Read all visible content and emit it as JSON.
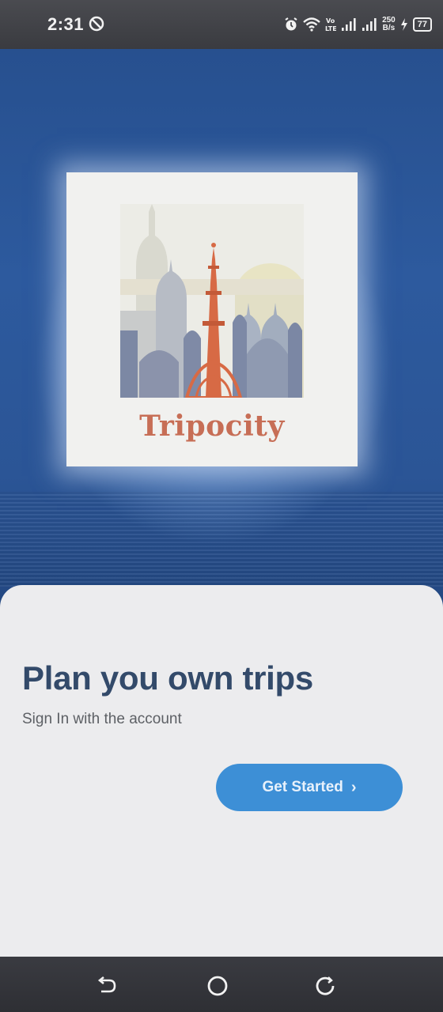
{
  "status_bar": {
    "time": "2:31",
    "network_speed_value": "250",
    "network_speed_unit": "B/s",
    "battery_level": "77",
    "icons": [
      "dnd-icon",
      "alarm-icon",
      "wifi-icon",
      "volte-icon",
      "signal-icon",
      "signal-icon",
      "charging-icon",
      "battery-icon"
    ]
  },
  "splash": {
    "brand_name": "Tripocity",
    "logo_icon": "city-skyline-illustration"
  },
  "welcome": {
    "headline": "Plan you own trips",
    "subtitle": "Sign In with the account",
    "cta_label": "Get Started",
    "cta_icon": "chevron-right-icon"
  },
  "nav_bar": {
    "icons": [
      "back-icon",
      "home-icon",
      "recents-icon"
    ]
  },
  "colors": {
    "primary_blue": "#2d5a9e",
    "button_blue": "#3d8fd6",
    "brand_text": "#c76e56",
    "headline_text": "#334a6a",
    "sheet_bg": "#ececee"
  }
}
